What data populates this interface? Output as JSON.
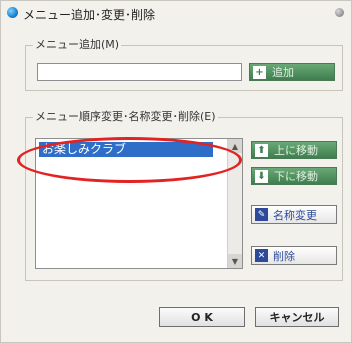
{
  "window": {
    "title": "メニュー追加･変更･削除"
  },
  "add_group": {
    "label": "メニュー追加(M)",
    "input_value": "",
    "add_button": "追加",
    "add_icon": "+"
  },
  "edit_group": {
    "label": "メニュー順序変更･名称変更･削除(E)",
    "items": [
      "お楽しみクラブ"
    ],
    "move_up_button": "上に移動",
    "move_down_button": "下に移動",
    "rename_button": "名称変更",
    "delete_button": "削除"
  },
  "footer": {
    "ok_button": "O K",
    "cancel_button": "キャンセル"
  },
  "colors": {
    "highlight": "#e32222",
    "selection": "#2f6ec8",
    "green_button": "#4f8f5e"
  }
}
